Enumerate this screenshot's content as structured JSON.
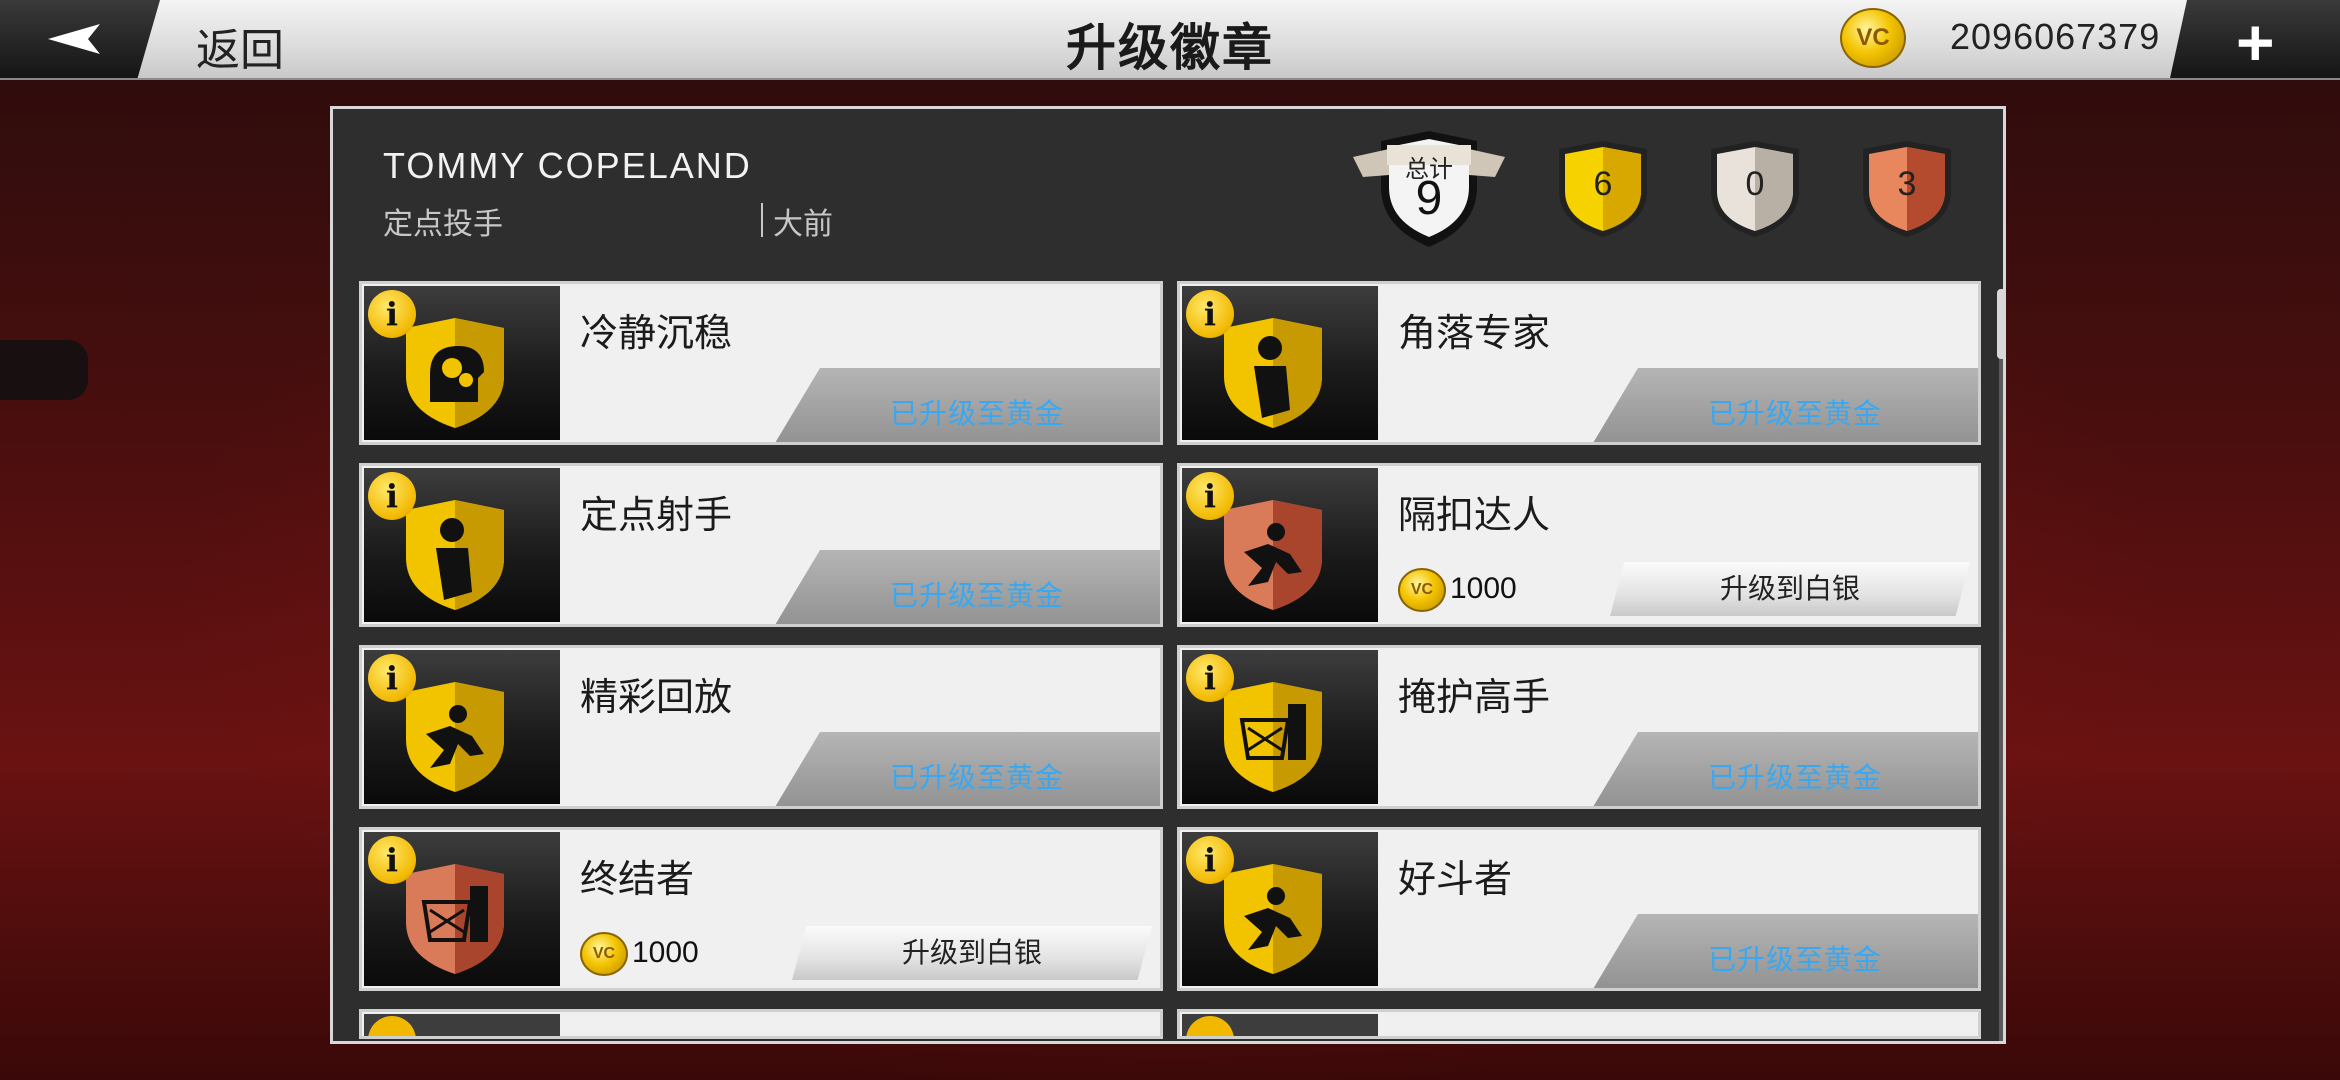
{
  "header": {
    "back_label": "返回",
    "title": "升级徽章",
    "vc_icon": "VC",
    "balance": "2096067379",
    "add_label": "+"
  },
  "player": {
    "name": "TOMMY COPELAND",
    "role": "定点投手",
    "position": "大前"
  },
  "summary": {
    "total_label": "总计",
    "total": "9",
    "gold": "6",
    "silver": "0",
    "bronze": "3"
  },
  "colors": {
    "gold": "#f2c400",
    "silver": "#d6d0c8",
    "bronze": "#c9573a",
    "status_blue": "#3aa8f0"
  },
  "badges": [
    {
      "name": "冷静沉稳",
      "tier": "gold",
      "icon": "gears-head-icon",
      "status": "已升级至黄金"
    },
    {
      "name": "角落专家",
      "tier": "gold",
      "icon": "corner-shooter-icon",
      "status": "已升级至黄金"
    },
    {
      "name": "定点射手",
      "tier": "gold",
      "icon": "spot-shooter-icon",
      "status": "已升级至黄金"
    },
    {
      "name": "隔扣达人",
      "tier": "bronze",
      "icon": "posterizer-icon",
      "cost": "1000",
      "button": "升级到白银"
    },
    {
      "name": "精彩回放",
      "tier": "gold",
      "icon": "highlight-dunk-icon",
      "status": "已升级至黄金"
    },
    {
      "name": "掩护高手",
      "tier": "gold",
      "icon": "screen-basket-icon",
      "status": "已升级至黄金"
    },
    {
      "name": "终结者",
      "tier": "bronze",
      "icon": "finisher-basket-icon",
      "cost": "1000",
      "button": "升级到白银"
    },
    {
      "name": "好斗者",
      "tier": "gold",
      "icon": "brawler-icon",
      "status": "已升级至黄金"
    }
  ]
}
